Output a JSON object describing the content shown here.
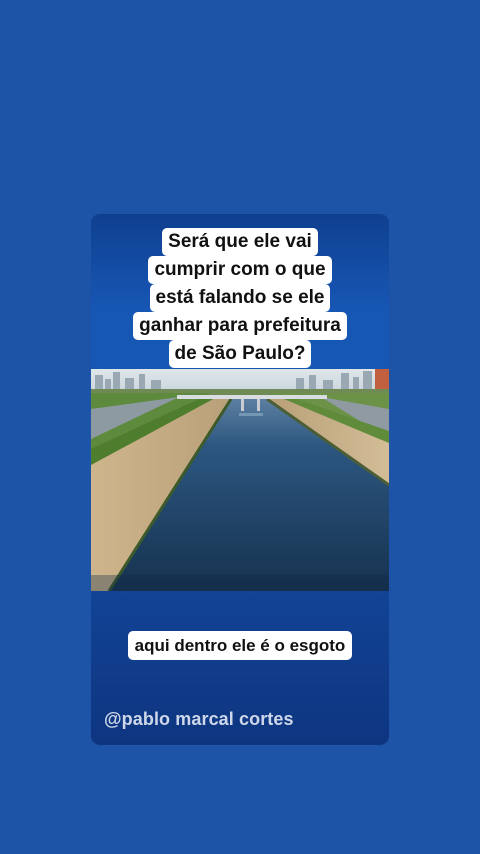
{
  "story": {
    "question_lines": [
      "Será que ele vai",
      "cumprir com o que",
      "está falando se ele",
      "ganhar para prefeitura",
      "de São Paulo?"
    ],
    "bottom_caption": "aqui dentro ele é o esgoto",
    "watermark": "@pablo marcal cortes"
  },
  "colors": {
    "page_background": "#1d54a8",
    "card_accent": "#1757b4",
    "caption_background": "#ffffff",
    "caption_text": "#111111",
    "river_water": "#1c3f6b"
  }
}
